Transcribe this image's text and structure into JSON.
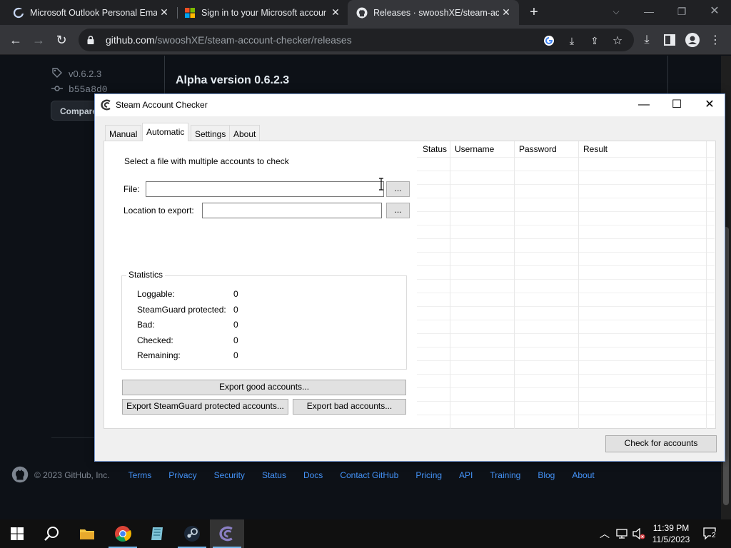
{
  "browser": {
    "tabs": [
      {
        "title": "Microsoft Outlook Personal Ema",
        "icon": "outlook-icon",
        "active": false
      },
      {
        "title": "Sign in to your Microsoft accour",
        "icon": "microsoft-logo-icon",
        "active": false
      },
      {
        "title": "Releases · swooshXE/steam-acc",
        "icon": "github-icon",
        "active": true
      }
    ],
    "url_host": "github.com",
    "url_path": "/swooshXE/steam-account-checker/releases",
    "accent": "#35363a"
  },
  "github": {
    "tag": "v0.6.2.3",
    "commit": "b55a8d0",
    "compare_label": "Compare",
    "release_title": "Alpha version 0.6.2.3",
    "copyright": "© 2023 GitHub, Inc.",
    "footer_links": [
      "Terms",
      "Privacy",
      "Security",
      "Status",
      "Docs",
      "Contact GitHub",
      "Pricing",
      "API",
      "Training",
      "Blog",
      "About"
    ],
    "link_color": "#4493f8"
  },
  "app": {
    "title": "Steam Account Checker",
    "tabs": [
      "Manual",
      "Automatic",
      "Settings",
      "About"
    ],
    "active_tab": "Automatic",
    "prompt": "Select a file with multiple accounts to check",
    "file_label": "File:",
    "file_value": "",
    "export_label": "Location to export:",
    "export_value": "",
    "browse_label": "...",
    "stats": {
      "legend": "Statistics",
      "rows": [
        {
          "label": "Loggable:",
          "value": "0"
        },
        {
          "label": "SteamGuard protected:",
          "value": "0"
        },
        {
          "label": "Bad:",
          "value": "0"
        },
        {
          "label": "Checked:",
          "value": "0"
        },
        {
          "label": "Remaining:",
          "value": "0"
        }
      ]
    },
    "buttons": {
      "export_good": "Export good accounts...",
      "export_steamguard": "Export SteamGuard protected accounts...",
      "export_bad": "Export bad accounts...",
      "check": "Check for accounts"
    },
    "grid_columns": [
      "Status",
      "Username",
      "Password",
      "Result"
    ]
  },
  "taskbar": {
    "time": "11:39 PM",
    "date": "11/5/2023",
    "notification_count": "2",
    "items": [
      "start-icon",
      "search-icon",
      "file-explorer-icon",
      "chrome-icon",
      "app-icon",
      "steam-icon",
      "steam-account-checker-icon"
    ]
  }
}
